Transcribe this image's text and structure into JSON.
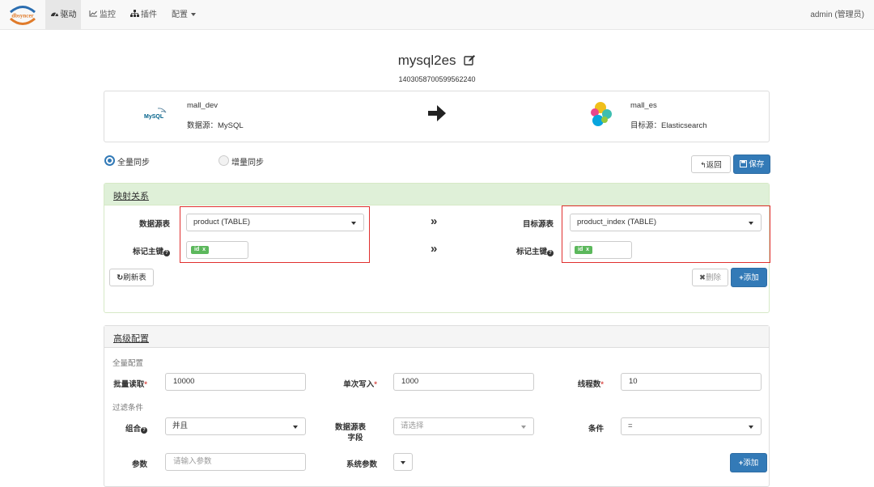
{
  "nav": {
    "logo_text": "dbsyncer",
    "items": [
      {
        "label": "驱动",
        "icon": "dashboard-icon"
      },
      {
        "label": "监控",
        "icon": "line-chart-icon"
      },
      {
        "label": "插件",
        "icon": "sitemap-icon"
      },
      {
        "label": "配置",
        "icon": "caret-down-icon"
      }
    ],
    "user": "admin (管理员)"
  },
  "header": {
    "title": "mysql2es",
    "id": "1403058700599562240"
  },
  "connection": {
    "source_name": "mall_dev",
    "source_type": "数据源：MySQL",
    "source_logo_text": "MySQL",
    "target_name": "mall_es",
    "target_type": "目标源：Elasticsearch"
  },
  "sync": {
    "full_label": "全量同步",
    "incremental_label": "增量同步",
    "selected": "full"
  },
  "actions": {
    "back_label": "返回",
    "save_label": "保存"
  },
  "mapping": {
    "title": "映射关系",
    "source_table_label": "数据源表",
    "source_table_value": "product (TABLE)",
    "source_key_label": "标记主键",
    "source_key_tag": "id",
    "target_table_label": "目标源表",
    "target_table_value": "product_index (TABLE)",
    "target_key_label": "标记主键",
    "target_key_tag": "id",
    "tag_remove": "x",
    "arrow": "»",
    "refresh_label": "刷新表",
    "delete_label": "删除",
    "add_label": "添加"
  },
  "advanced": {
    "title": "高级配置",
    "full_section": "全量配置",
    "batch_read_label": "批量读取",
    "batch_read_value": "10000",
    "single_write_label": "单次写入",
    "single_write_value": "1000",
    "threads_label": "线程数",
    "threads_value": "10",
    "filter_section": "过滤条件",
    "combine_label": "组合",
    "combine_value": "并且",
    "source_field_label_1": "数据源表",
    "source_field_label_2": "字段",
    "source_field_placeholder": "请选择",
    "condition_label": "条件",
    "condition_value": "=",
    "param_label": "参数",
    "param_placeholder": "请输入参数",
    "sys_param_label": "系统参数",
    "add_label": "添加"
  },
  "colors": {
    "primary": "#337ab7",
    "success": "#5cb85c",
    "highlight": "#e0302f",
    "panel_green": "#dff0d8"
  }
}
